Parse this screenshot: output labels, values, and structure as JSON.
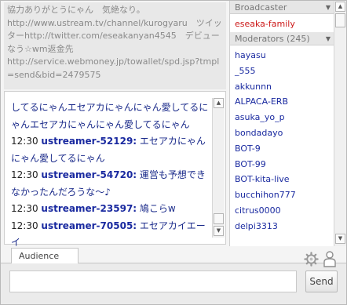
{
  "info": {
    "lines": [
      "協力ありがとうにゃん　気絶なり。",
      "http://www.ustream.tv/channel/kurogyaru　ツイッターhttp://twitter.com/eseakanyan4545　デビューなう☆wm返金先",
      "http://service.webmoney.jp/towallet/spd.jsp?tmpl=send&bid=2479575"
    ]
  },
  "chat": {
    "messages": [
      {
        "time": "",
        "user": "",
        "text": "してるにゃんエセアカにゃんにゃん愛してるにゃんエセアカにゃんにゃん愛してるにゃん"
      },
      {
        "time": "12:30",
        "user": "ustreamer-52129:",
        "text": "エセアカにゃんにゃん愛してるにゃん"
      },
      {
        "time": "12:30",
        "user": "ustreamer-54720:",
        "text": "運営も予想できなかったんだろうな～♪"
      },
      {
        "time": "12:30",
        "user": "ustreamer-23597:",
        "text": "鳩こらw"
      },
      {
        "time": "12:30",
        "user": "ustreamer-70505:",
        "text": "エセアカイエーイ"
      }
    ]
  },
  "broadcaster": {
    "header": "Broadcaster",
    "name": "eseaka-family"
  },
  "moderators": {
    "header": "Moderators (245)",
    "names": [
      "hayasu",
      "_555",
      "akkunnn",
      "ALPACA-ERB",
      "asuka_yo_p",
      "bondadayo",
      "BOT-9",
      "BOT-99",
      "BOT-kita-live",
      "bucchihon777",
      "citrus0000",
      "delpi3313"
    ]
  },
  "tabs": {
    "audience": "Audience"
  },
  "input": {
    "placeholder": ""
  },
  "send_label": "Send",
  "icons": {
    "settings": "gear-icon",
    "profile": "person-icon",
    "collapse": "triangle-down-icon"
  },
  "colors": {
    "broadcaster_name": "#cc1818",
    "username": "#1a2aa0"
  }
}
